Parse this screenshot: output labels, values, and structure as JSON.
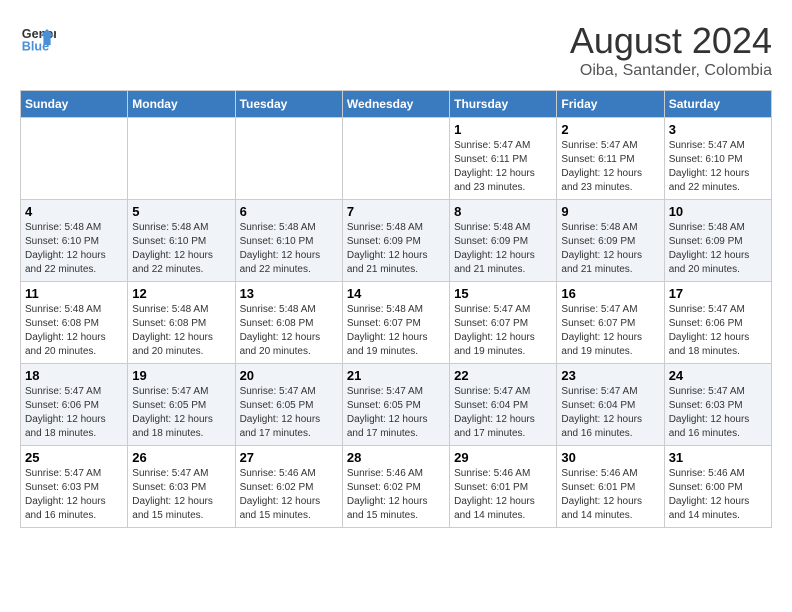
{
  "header": {
    "logo_line1": "General",
    "logo_line2": "Blue",
    "title": "August 2024",
    "subtitle": "Oiba, Santander, Colombia"
  },
  "weekdays": [
    "Sunday",
    "Monday",
    "Tuesday",
    "Wednesday",
    "Thursday",
    "Friday",
    "Saturday"
  ],
  "weeks": [
    [
      {
        "day": "",
        "info": ""
      },
      {
        "day": "",
        "info": ""
      },
      {
        "day": "",
        "info": ""
      },
      {
        "day": "",
        "info": ""
      },
      {
        "day": "1",
        "info": "Sunrise: 5:47 AM\nSunset: 6:11 PM\nDaylight: 12 hours\nand 23 minutes."
      },
      {
        "day": "2",
        "info": "Sunrise: 5:47 AM\nSunset: 6:11 PM\nDaylight: 12 hours\nand 23 minutes."
      },
      {
        "day": "3",
        "info": "Sunrise: 5:47 AM\nSunset: 6:10 PM\nDaylight: 12 hours\nand 22 minutes."
      }
    ],
    [
      {
        "day": "4",
        "info": "Sunrise: 5:48 AM\nSunset: 6:10 PM\nDaylight: 12 hours\nand 22 minutes."
      },
      {
        "day": "5",
        "info": "Sunrise: 5:48 AM\nSunset: 6:10 PM\nDaylight: 12 hours\nand 22 minutes."
      },
      {
        "day": "6",
        "info": "Sunrise: 5:48 AM\nSunset: 6:10 PM\nDaylight: 12 hours\nand 22 minutes."
      },
      {
        "day": "7",
        "info": "Sunrise: 5:48 AM\nSunset: 6:09 PM\nDaylight: 12 hours\nand 21 minutes."
      },
      {
        "day": "8",
        "info": "Sunrise: 5:48 AM\nSunset: 6:09 PM\nDaylight: 12 hours\nand 21 minutes."
      },
      {
        "day": "9",
        "info": "Sunrise: 5:48 AM\nSunset: 6:09 PM\nDaylight: 12 hours\nand 21 minutes."
      },
      {
        "day": "10",
        "info": "Sunrise: 5:48 AM\nSunset: 6:09 PM\nDaylight: 12 hours\nand 20 minutes."
      }
    ],
    [
      {
        "day": "11",
        "info": "Sunrise: 5:48 AM\nSunset: 6:08 PM\nDaylight: 12 hours\nand 20 minutes."
      },
      {
        "day": "12",
        "info": "Sunrise: 5:48 AM\nSunset: 6:08 PM\nDaylight: 12 hours\nand 20 minutes."
      },
      {
        "day": "13",
        "info": "Sunrise: 5:48 AM\nSunset: 6:08 PM\nDaylight: 12 hours\nand 20 minutes."
      },
      {
        "day": "14",
        "info": "Sunrise: 5:48 AM\nSunset: 6:07 PM\nDaylight: 12 hours\nand 19 minutes."
      },
      {
        "day": "15",
        "info": "Sunrise: 5:47 AM\nSunset: 6:07 PM\nDaylight: 12 hours\nand 19 minutes."
      },
      {
        "day": "16",
        "info": "Sunrise: 5:47 AM\nSunset: 6:07 PM\nDaylight: 12 hours\nand 19 minutes."
      },
      {
        "day": "17",
        "info": "Sunrise: 5:47 AM\nSunset: 6:06 PM\nDaylight: 12 hours\nand 18 minutes."
      }
    ],
    [
      {
        "day": "18",
        "info": "Sunrise: 5:47 AM\nSunset: 6:06 PM\nDaylight: 12 hours\nand 18 minutes."
      },
      {
        "day": "19",
        "info": "Sunrise: 5:47 AM\nSunset: 6:05 PM\nDaylight: 12 hours\nand 18 minutes."
      },
      {
        "day": "20",
        "info": "Sunrise: 5:47 AM\nSunset: 6:05 PM\nDaylight: 12 hours\nand 17 minutes."
      },
      {
        "day": "21",
        "info": "Sunrise: 5:47 AM\nSunset: 6:05 PM\nDaylight: 12 hours\nand 17 minutes."
      },
      {
        "day": "22",
        "info": "Sunrise: 5:47 AM\nSunset: 6:04 PM\nDaylight: 12 hours\nand 17 minutes."
      },
      {
        "day": "23",
        "info": "Sunrise: 5:47 AM\nSunset: 6:04 PM\nDaylight: 12 hours\nand 16 minutes."
      },
      {
        "day": "24",
        "info": "Sunrise: 5:47 AM\nSunset: 6:03 PM\nDaylight: 12 hours\nand 16 minutes."
      }
    ],
    [
      {
        "day": "25",
        "info": "Sunrise: 5:47 AM\nSunset: 6:03 PM\nDaylight: 12 hours\nand 16 minutes."
      },
      {
        "day": "26",
        "info": "Sunrise: 5:47 AM\nSunset: 6:03 PM\nDaylight: 12 hours\nand 15 minutes."
      },
      {
        "day": "27",
        "info": "Sunrise: 5:46 AM\nSunset: 6:02 PM\nDaylight: 12 hours\nand 15 minutes."
      },
      {
        "day": "28",
        "info": "Sunrise: 5:46 AM\nSunset: 6:02 PM\nDaylight: 12 hours\nand 15 minutes."
      },
      {
        "day": "29",
        "info": "Sunrise: 5:46 AM\nSunset: 6:01 PM\nDaylight: 12 hours\nand 14 minutes."
      },
      {
        "day": "30",
        "info": "Sunrise: 5:46 AM\nSunset: 6:01 PM\nDaylight: 12 hours\nand 14 minutes."
      },
      {
        "day": "31",
        "info": "Sunrise: 5:46 AM\nSunset: 6:00 PM\nDaylight: 12 hours\nand 14 minutes."
      }
    ]
  ]
}
